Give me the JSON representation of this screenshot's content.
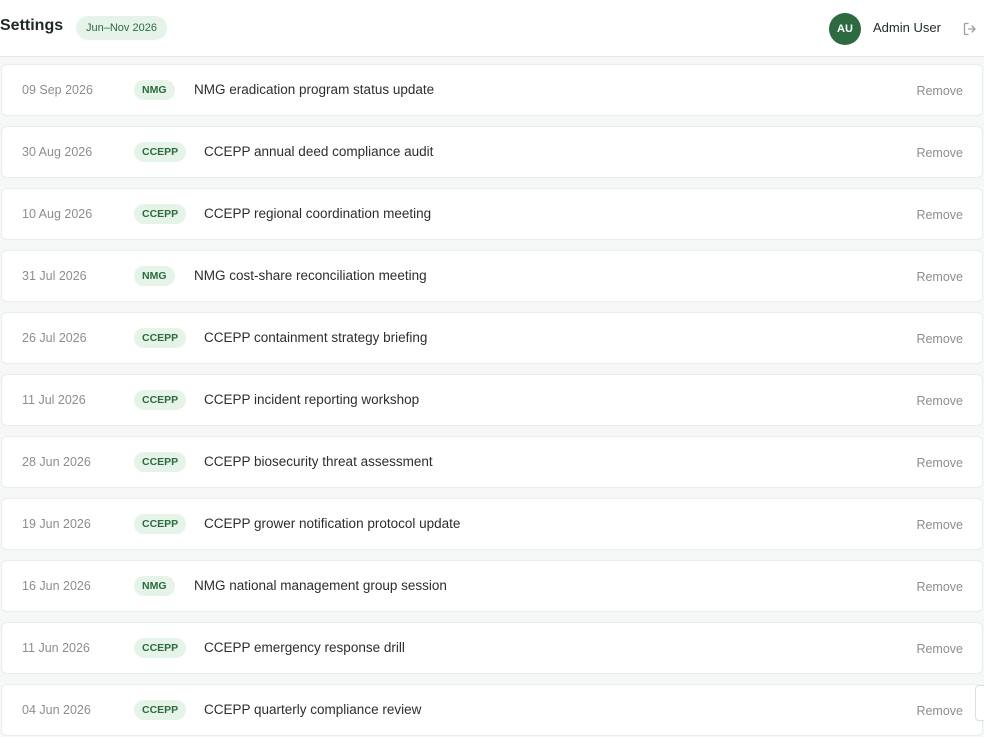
{
  "header": {
    "title": "Settings",
    "range_badge": "Jun–Nov 2026",
    "user": {
      "initials": "AU",
      "name": "Admin User"
    }
  },
  "icons": {
    "logout": "logout-icon"
  },
  "colors": {
    "accent": "#2d6a3f",
    "tag_bg": "#e5f3e8",
    "tag_text": "#2c6b3e"
  },
  "items": [
    {
      "date": "09 Sep 2026",
      "tag": "NMG",
      "title": "NMG eradication program status update",
      "action": "Remove"
    },
    {
      "date": "30 Aug 2026",
      "tag": "CCEPP",
      "title": "CCEPP annual deed compliance audit",
      "action": "Remove"
    },
    {
      "date": "10 Aug 2026",
      "tag": "CCEPP",
      "title": "CCEPP regional coordination meeting",
      "action": "Remove"
    },
    {
      "date": "31 Jul 2026",
      "tag": "NMG",
      "title": "NMG cost-share reconciliation meeting",
      "action": "Remove"
    },
    {
      "date": "26 Jul 2026",
      "tag": "CCEPP",
      "title": "CCEPP containment strategy briefing",
      "action": "Remove"
    },
    {
      "date": "11 Jul 2026",
      "tag": "CCEPP",
      "title": "CCEPP incident reporting workshop",
      "action": "Remove"
    },
    {
      "date": "28 Jun 2026",
      "tag": "CCEPP",
      "title": "CCEPP biosecurity threat assessment",
      "action": "Remove"
    },
    {
      "date": "19 Jun 2026",
      "tag": "CCEPP",
      "title": "CCEPP grower notification protocol update",
      "action": "Remove"
    },
    {
      "date": "16 Jun 2026",
      "tag": "NMG",
      "title": "NMG national management group session",
      "action": "Remove"
    },
    {
      "date": "11 Jun 2026",
      "tag": "CCEPP",
      "title": "CCEPP emergency response drill",
      "action": "Remove"
    },
    {
      "date": "04 Jun 2026",
      "tag": "CCEPP",
      "title": "CCEPP quarterly compliance review",
      "action": "Remove"
    }
  ]
}
